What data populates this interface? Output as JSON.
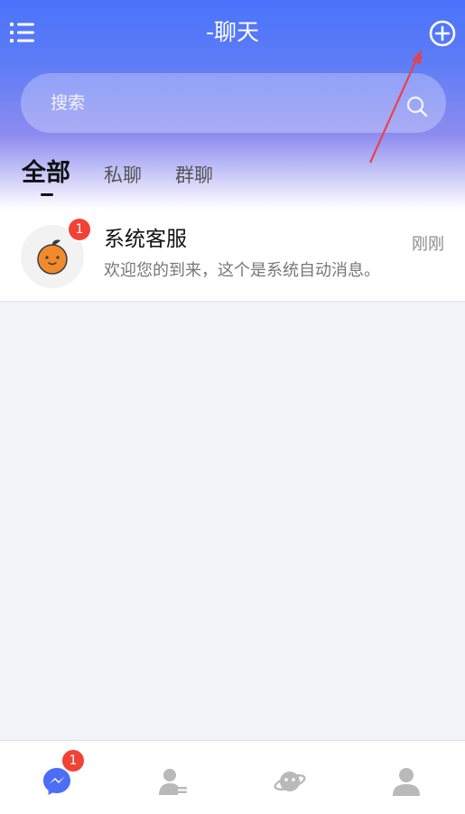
{
  "header": {
    "title": "-聊天",
    "menu_icon": "menu-list-icon",
    "add_icon": "plus-circle-icon"
  },
  "search": {
    "placeholder": "搜索",
    "icon": "search-icon"
  },
  "tabs": [
    {
      "label": "全部",
      "active": true
    },
    {
      "label": "私聊",
      "active": false
    },
    {
      "label": "群聊",
      "active": false
    }
  ],
  "chats": [
    {
      "name": "系统客服",
      "time": "刚刚",
      "preview": "欢迎您的到来，这个是系统自动消息。",
      "unread": "1",
      "avatar_icon": "orange-mascot-icon"
    }
  ],
  "bottom_nav": [
    {
      "icon": "messenger-icon",
      "badge": "1",
      "active": true,
      "color": "#4b6ef5"
    },
    {
      "icon": "contacts-icon",
      "active": false,
      "color": "#b9b9b9"
    },
    {
      "icon": "planet-icon",
      "active": false,
      "color": "#b9b9b9"
    },
    {
      "icon": "profile-icon",
      "active": false,
      "color": "#b9b9b9"
    }
  ],
  "colors": {
    "primary": "#4a73fb",
    "badge": "#f24236",
    "background": "#f2f3f8"
  }
}
